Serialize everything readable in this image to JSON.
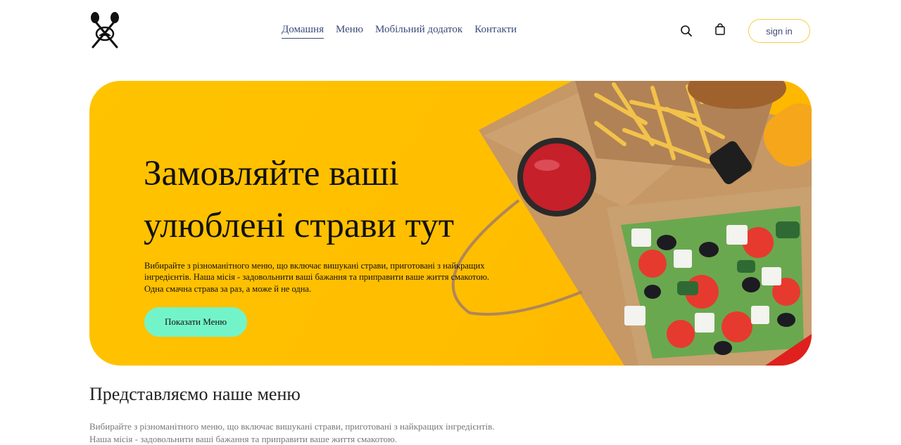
{
  "nav": {
    "items": [
      {
        "label": "Домашня",
        "active": true
      },
      {
        "label": "Меню",
        "active": false
      },
      {
        "label": "Мобільний додаток",
        "active": false
      },
      {
        "label": "Контакти",
        "active": false
      }
    ]
  },
  "header": {
    "logo_icon": "crossed-spoon-fork-icon",
    "search_icon": "search-icon",
    "cart_icon": "shopping-bag-icon",
    "signin_label": "sign in",
    "accent_color": "#f5cd4a"
  },
  "hero": {
    "title_line1": "Замовляйте ваші",
    "title_line2": "улюблені страви тут",
    "text": "Вибирайте з різноманітного меню, що включає вишукані страви, приготовані з найкращих інгредієнтів. Наша місія - задовольнити ваші бажання та приправити ваше життя смакотою. Одна смачна страва за раз, а може й не одна.",
    "button_label": "Показати Меню",
    "background_color": "#ffc300",
    "button_color": "#73f4c8",
    "image_icon": "food-delivery-image"
  },
  "intro": {
    "title": "Представляємо наше меню",
    "line1": "Вибирайте з різноманітного меню, що включає вишукані страви, приготовані з найкращих інгредієнтів.",
    "line2": "Наша місія - задовольнити ваші бажання та приправити ваше життя смакотою."
  }
}
